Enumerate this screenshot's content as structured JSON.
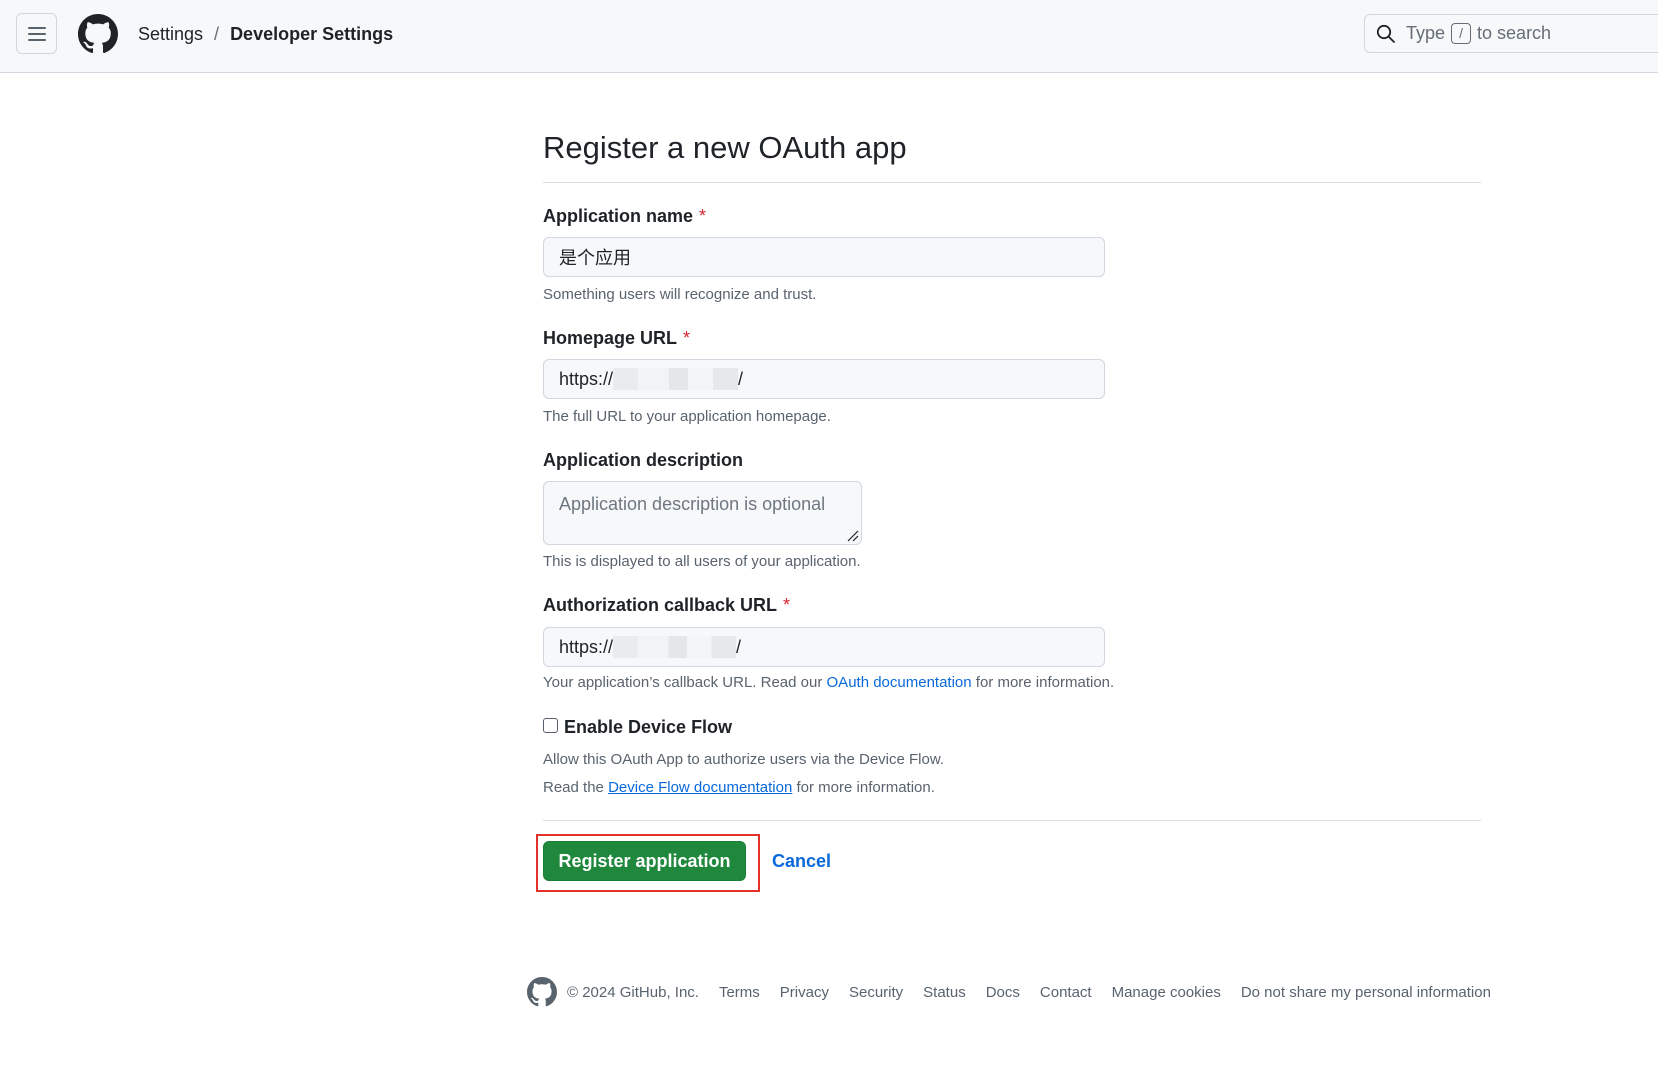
{
  "header": {
    "menu_icon": "hamburger-menu-icon",
    "logo_icon": "github-logo-icon",
    "breadcrumb": {
      "parent": "Settings",
      "separator": "/",
      "current": "Developer Settings"
    },
    "search": {
      "prefix": "Type",
      "key": "/",
      "suffix": "to search",
      "icon": "search-icon"
    }
  },
  "form": {
    "title": "Register a new OAuth app",
    "required_marker": "*",
    "app_name": {
      "label": "Application name",
      "value": "是个应用",
      "note": "Something users will recognize and trust."
    },
    "homepage_url": {
      "label": "Homepage URL",
      "value_prefix": "https://",
      "value_suffix": "/",
      "note": "The full URL to your application homepage."
    },
    "description": {
      "label": "Application description",
      "placeholder": "Application description is optional",
      "note": "This is displayed to all users of your application."
    },
    "callback_url": {
      "label": "Authorization callback URL",
      "value_prefix": "https://",
      "value_suffix": "/",
      "note_before": "Your application’s callback URL. Read our",
      "note_link": "OAuth documentation",
      "note_after": "for more information."
    },
    "device_flow": {
      "label": "Enable Device Flow",
      "checked": false,
      "note1": "Allow this OAuth App to authorize users via the Device Flow.",
      "note2_before": "Read the",
      "note2_link": "Device Flow documentation",
      "note2_after": "for more information."
    },
    "submit_label": "Register application",
    "cancel_label": "Cancel"
  },
  "footer": {
    "copyright": "© 2024 GitHub, Inc.",
    "links": [
      "Terms",
      "Privacy",
      "Security",
      "Status",
      "Docs",
      "Contact",
      "Manage cookies",
      "Do not share my personal information"
    ]
  },
  "colors": {
    "primary_button": "#1f883d",
    "link": "#0969da",
    "required": "#d1242f",
    "highlight_box": "#e5312c"
  }
}
